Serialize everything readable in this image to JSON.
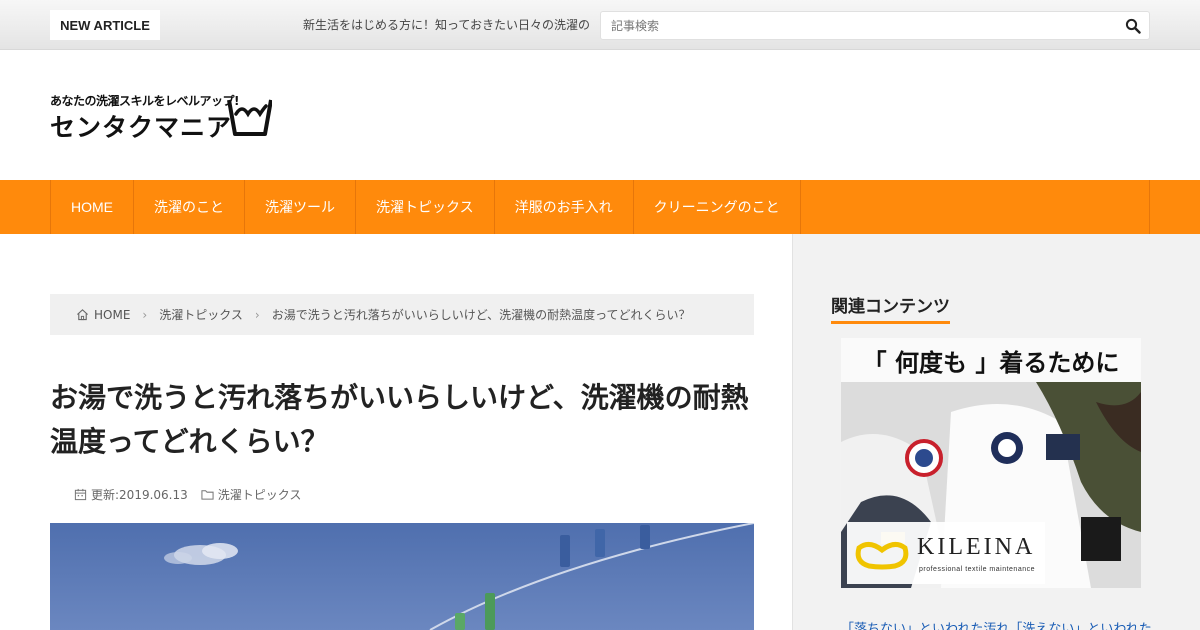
{
  "topbar": {
    "badge": "NEW ARTICLE",
    "ticker": "新生活をはじめる方に！知っておきたい日々の洗濯の",
    "search_placeholder": "記事検索",
    "search_icon": "search-icon"
  },
  "logo": {
    "tagline": "あなたの洗濯スキルをレベルアップ!",
    "name": "センタクマニア",
    "icon": "wash-tub-icon"
  },
  "nav": {
    "items": [
      {
        "label": "HOME"
      },
      {
        "label": "洗濯のこと"
      },
      {
        "label": "洗濯ツール"
      },
      {
        "label": "洗濯トピックス"
      },
      {
        "label": "洋服のお手入れ"
      },
      {
        "label": "クリーニングのこと"
      }
    ]
  },
  "breadcrumb": {
    "home": "HOME",
    "category": "洗濯トピックス",
    "current": "お湯で洗うと汚れ落ちがいいらしいけど、洗濯機の耐熱温度ってどれくらい？"
  },
  "article": {
    "title": "お湯で洗うと汚れ落ちがいいらしいけど、洗濯機の耐熱温度ってどれくらい？",
    "updated": "更新:2019.06.13",
    "category": "洗濯トピックス"
  },
  "sidebar": {
    "title": "関連コンテンツ",
    "ad": {
      "headline": "「 何度も 」着るために",
      "brand": "KILEINA",
      "brand_sub": "professional textile maintenance"
    },
    "link": "「落ちない」といわれた汚れ「洗えない」といわれた"
  },
  "colors": {
    "accent": "#ff8a0c",
    "link": "#1a5db5"
  }
}
